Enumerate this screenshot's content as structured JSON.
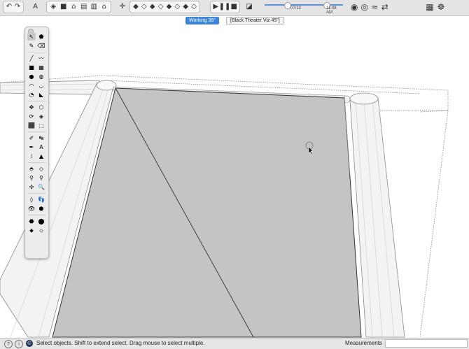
{
  "toolbar": {
    "group1": [
      "↶",
      "↷"
    ],
    "group2": [
      "A"
    ],
    "group3": [
      "◈",
      "■",
      "⌂",
      "▤",
      "▥",
      "⌂"
    ],
    "group4": [
      "✛"
    ],
    "group5": [
      "◆",
      "◇",
      "◆",
      "◇",
      "◆",
      "◇",
      "◆",
      "◇"
    ],
    "group6": [
      "▶",
      "❚❚",
      "■"
    ],
    "group7": [
      "◪"
    ],
    "anim_time": "07/12",
    "anim_clock": "11:48 AM",
    "group8": [
      "◉",
      "◎",
      "≈",
      "⇄"
    ],
    "group9": [
      "▦",
      "☸"
    ]
  },
  "scene_tabs": [
    {
      "label": "Working  36\"",
      "active": true
    },
    {
      "label": "[Black Theater Viz 45\"]",
      "active": false
    }
  ],
  "palette": {
    "tools": [
      [
        "↖",
        "⬟"
      ],
      [
        "✎",
        "⌫"
      ],
      [
        "╱",
        "〰"
      ],
      [
        "■",
        "▦"
      ],
      [
        "●",
        "◍"
      ],
      [
        "◠",
        "◡"
      ],
      [
        "◔",
        "◣"
      ],
      [
        "✥",
        "⬡"
      ],
      [
        "⟳",
        "◈"
      ],
      [
        "⬛",
        "⬚"
      ],
      [
        "✐",
        "↹"
      ],
      [
        "✒",
        "A"
      ],
      [
        "⁞",
        "▲"
      ],
      [
        "⬘",
        "◇"
      ],
      [
        "⚲",
        "⚲"
      ],
      [
        "✣",
        "🔍"
      ],
      [
        "◊",
        "👣"
      ],
      [
        "👁",
        "⬢"
      ],
      [
        "⬣",
        "⬤"
      ],
      [
        "⬥",
        "⬦"
      ]
    ]
  },
  "status": {
    "icon1": "?",
    "icon2": "i",
    "icon3": "©",
    "text": "Select objects. Shift to extend select. Drag mouse to select multiple.",
    "measurements_label": "Measurements",
    "measurements_value": ""
  }
}
